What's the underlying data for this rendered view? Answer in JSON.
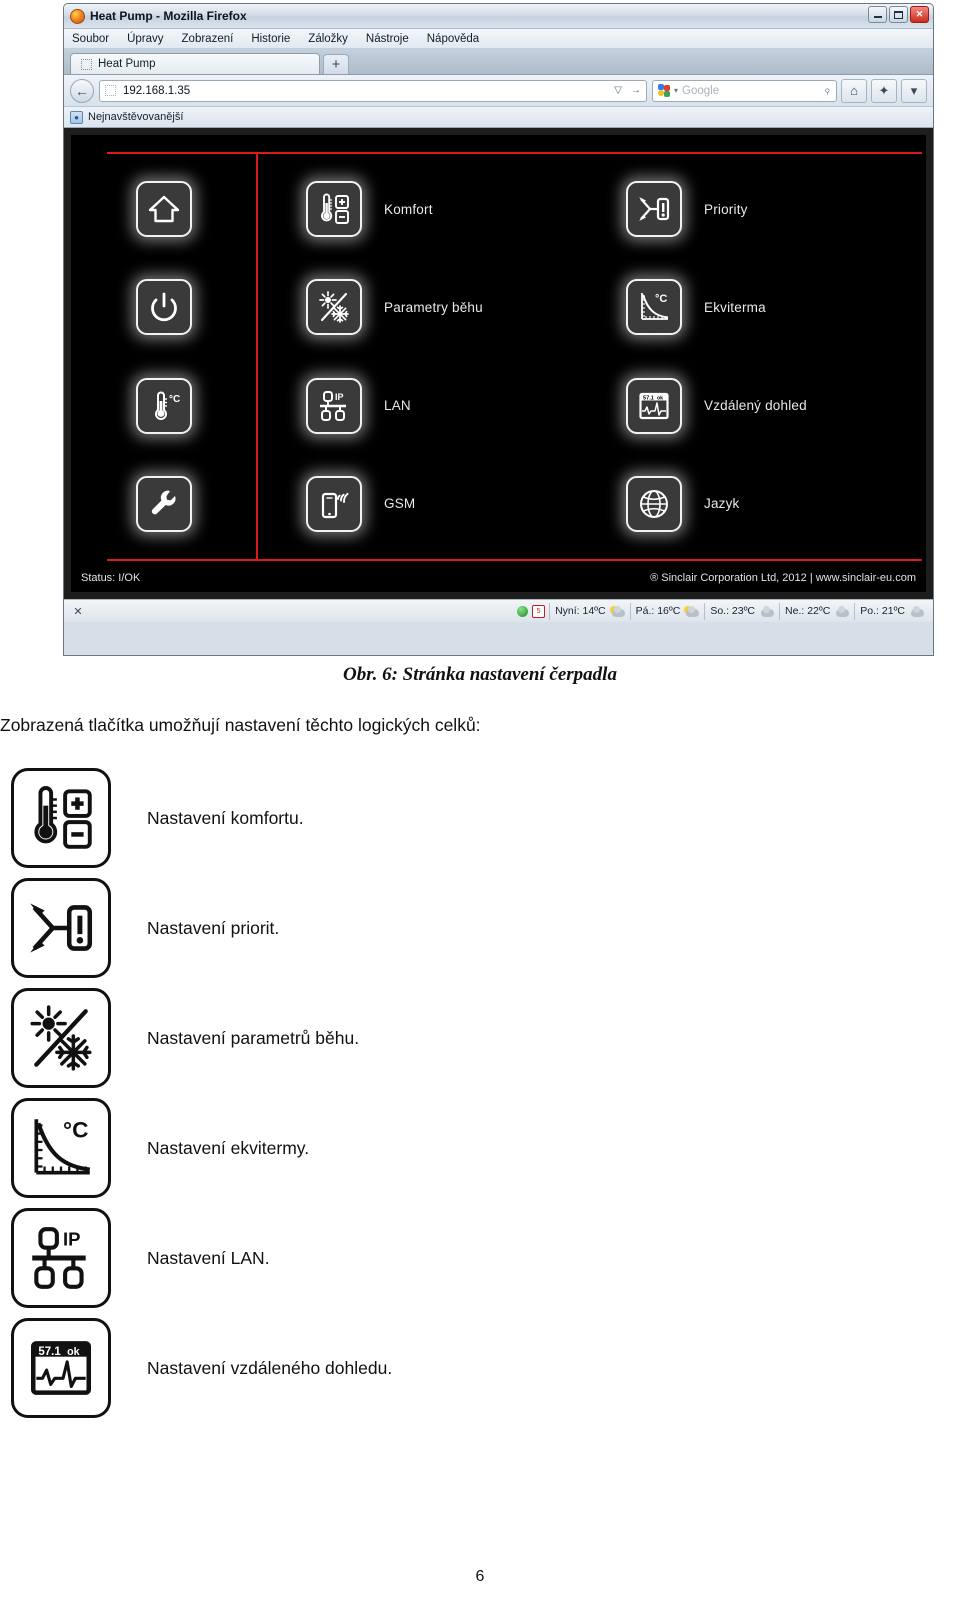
{
  "browser": {
    "title": "Heat Pump - Mozilla Firefox",
    "window_buttons": {
      "minimize": "–",
      "maximize": "□",
      "close": "✕"
    },
    "menu": [
      {
        "label": "Soubor",
        "accel": "S"
      },
      {
        "label": "Úpravy",
        "accel": "a"
      },
      {
        "label": "Zobrazení",
        "accel": "Z"
      },
      {
        "label": "Historie",
        "accel": "H"
      },
      {
        "label": "Záložky",
        "accel": "o"
      },
      {
        "label": "Nástroje",
        "accel": "N"
      },
      {
        "label": "Nápověda",
        "accel": "v"
      }
    ],
    "tab": {
      "label": "Heat Pump"
    },
    "new_tab_label": "+",
    "back_glyph": "←",
    "url": "192.168.1.35",
    "url_dropdown_glyph": "▽",
    "url_go_glyph": "→",
    "search": {
      "engine": "Google",
      "placeholder": "Google",
      "caret": "▾",
      "magnifier_glyph": "⌕"
    },
    "home_glyph": "⌂",
    "addons_glyph": "✦",
    "toolbar_overflow_glyph": "▾",
    "bookmark": {
      "label": "Nejnavštěvovanější",
      "icon": "bookmark-folder-icon"
    }
  },
  "heatpump": {
    "left_buttons": [
      {
        "name": "home",
        "label": ""
      },
      {
        "name": "power",
        "label": ""
      },
      {
        "name": "temperature",
        "label": ""
      },
      {
        "name": "service",
        "label": ""
      }
    ],
    "middle_buttons": [
      {
        "icon": "comfort-thermometer-icon",
        "label": "Komfort"
      },
      {
        "icon": "run-parameters-sun-snow-icon",
        "label": "Parametry běhu"
      },
      {
        "icon": "lan-ip-network-icon",
        "label": "LAN"
      },
      {
        "icon": "gsm-phone-signal-icon",
        "label": "GSM"
      }
    ],
    "right_buttons": [
      {
        "icon": "priority-branch-alert-icon",
        "label": "Priority"
      },
      {
        "icon": "equithermal-curve-icon",
        "label": "Ekviterma"
      },
      {
        "icon": "remote-monitoring-display-icon",
        "label": "Vzdálený dohled"
      },
      {
        "icon": "language-globe-icon",
        "label": "Jazyk"
      }
    ],
    "status": "Status: I/OK",
    "copyright": "® Sinclair Corporation Ltd, 2012 | www.sinclair-eu.com",
    "remote_display": {
      "value": "57.1",
      "state": "ok"
    },
    "lan_badge": "IP",
    "temperature_unit": "°C"
  },
  "addon_bar": {
    "close_glyph": "✕",
    "status_dot": "green-status-dot",
    "calendar_day": "5",
    "weather": [
      {
        "label": "Nyní: 14ºC",
        "icon": "sun-cloud-icon"
      },
      {
        "label": "Pá.: 16ºC",
        "icon": "sun-cloud-icon"
      },
      {
        "label": "So.: 23ºC",
        "icon": "cloud-icon"
      },
      {
        "label": "Ne.: 22ºC",
        "icon": "cloud-icon"
      },
      {
        "label": "Po.: 21ºC",
        "icon": "cloud-icon"
      }
    ]
  },
  "document": {
    "figure_caption": "Obr. 6: Stránka nastavení čerpadla",
    "intro": "Zobrazená tlačítka umožňují nastavení těchto logických celků:",
    "items": [
      {
        "icon": "comfort-thermometer-icon",
        "text": "Nastavení komfortu."
      },
      {
        "icon": "priority-branch-alert-icon",
        "text": "Nastavení priorit."
      },
      {
        "icon": "run-parameters-sun-snow-icon",
        "text": "Nastavení parametrů běhu."
      },
      {
        "icon": "equithermal-curve-icon",
        "text": "Nastavení ekvitermy."
      },
      {
        "icon": "lan-ip-network-icon",
        "text": "Nastavení LAN."
      },
      {
        "icon": "remote-monitoring-display-icon",
        "text": "Nastavení vzdáleného dohledu."
      }
    ],
    "page_number": "6"
  }
}
